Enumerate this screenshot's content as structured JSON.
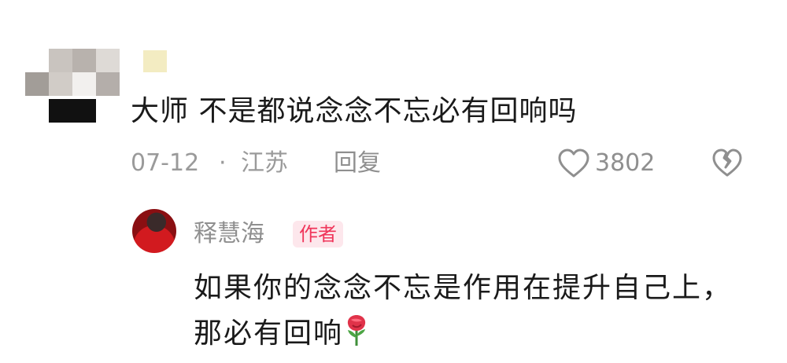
{
  "comment": {
    "text": "大师 不是都说念念不忘必有回响吗",
    "date": "07-12",
    "separator": "·",
    "location": "江苏",
    "reply_label": "回复",
    "like_count": "3802"
  },
  "reply": {
    "author_name": "释慧海",
    "badge": "作者",
    "text": "如果你的念念不忘是作用在提升自己上，那必有回响"
  },
  "icons": {
    "like": "heart-outline-icon",
    "dislike": "broken-heart-icon",
    "emoji": "rose-icon"
  },
  "colors": {
    "meta_gray": "#9a9a9a",
    "badge_bg": "#fde7ec",
    "badge_text": "#f0355a"
  }
}
